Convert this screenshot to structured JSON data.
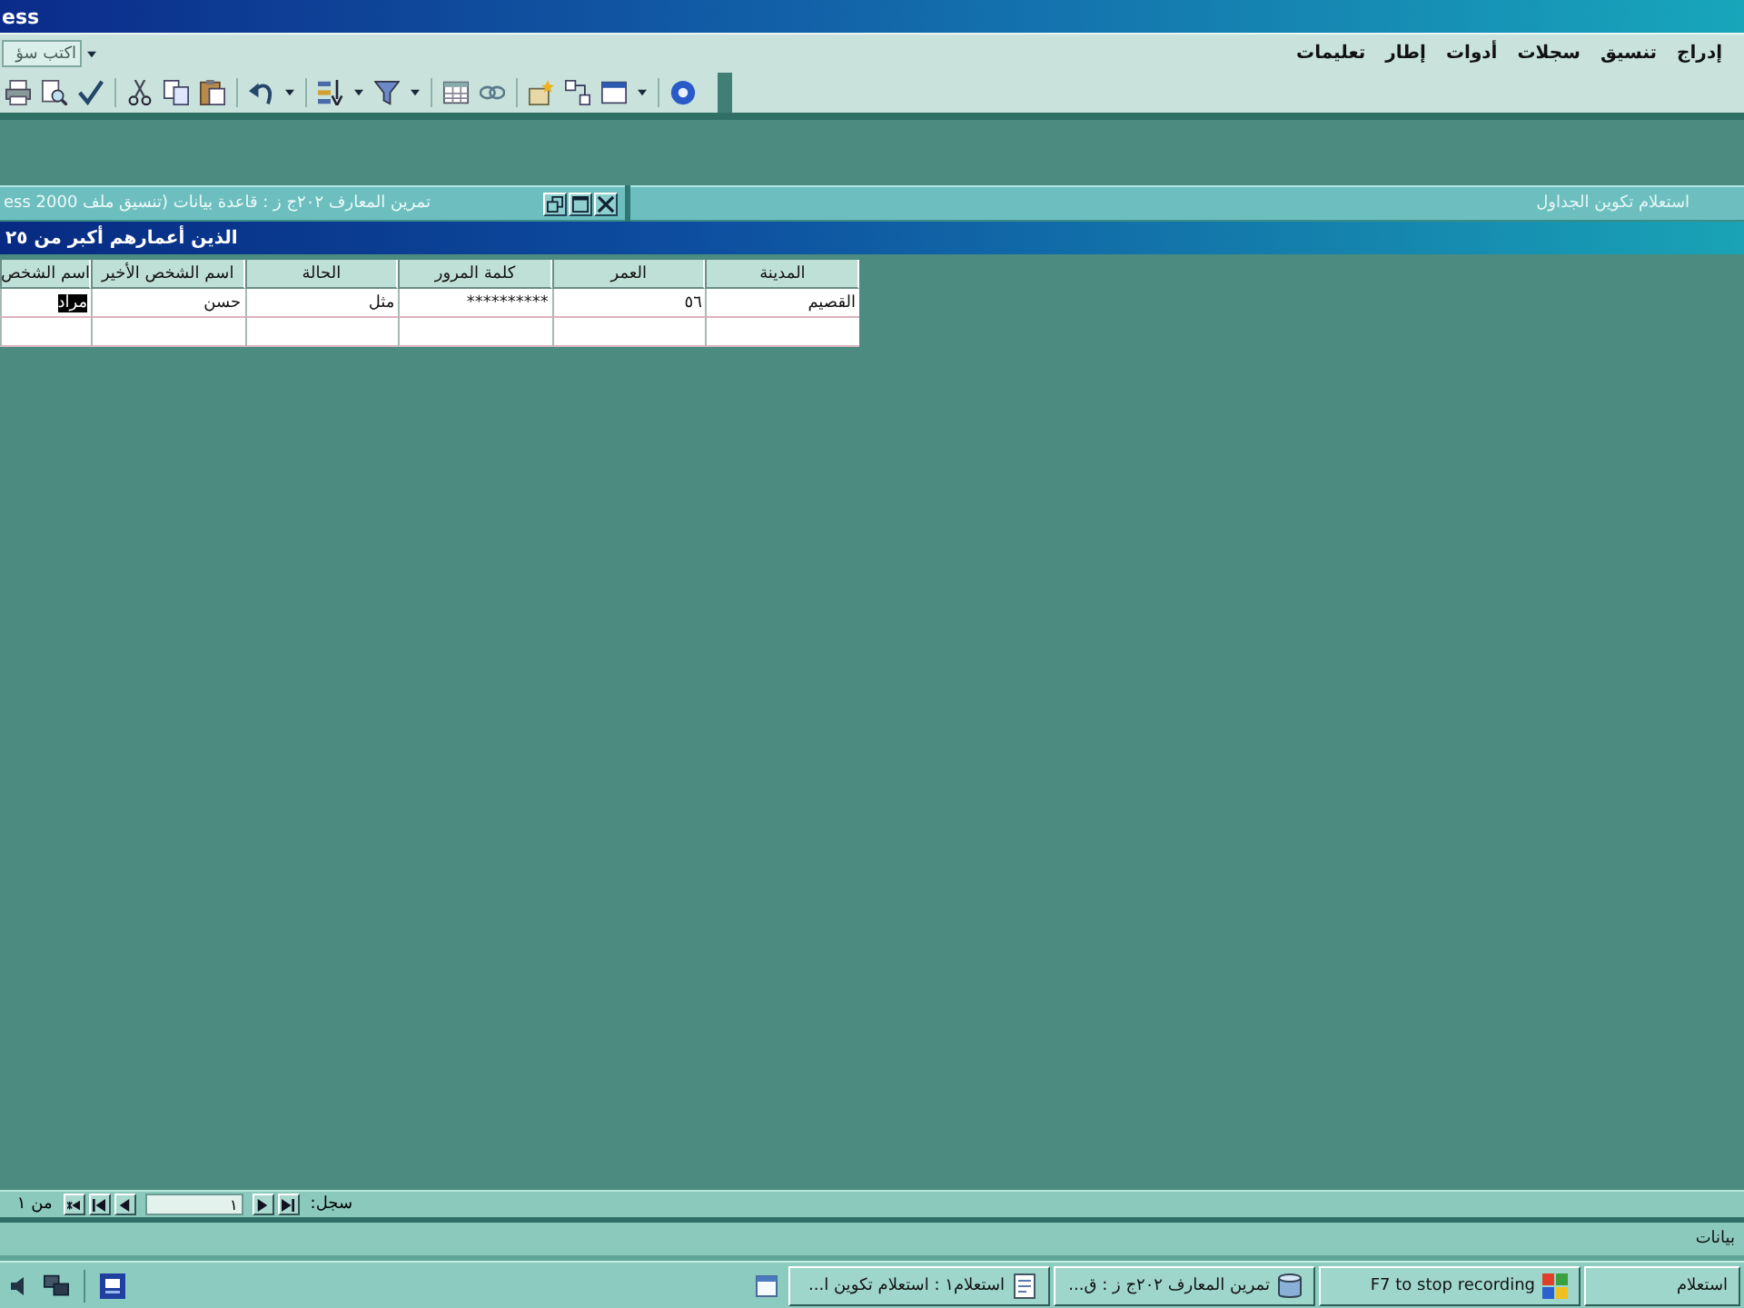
{
  "window": {
    "title": "ess"
  },
  "menu_bar": {
    "help_box": {
      "placeholder": "اكتب سؤ"
    },
    "items": [
      "إدراج",
      "تنسيق",
      "سجلات",
      "أدوات",
      "إطار",
      "تعليمات"
    ]
  },
  "database_window": {
    "title": "تمرين المعارف ٢٠٢ج ز : قاعدة بيانات (تنسيق ملف ess 2000"
  },
  "minimized_window": {
    "title": "استعلام تكوين الجداول"
  },
  "query_window": {
    "title": "الذين أعمارهم أكبر من ٢٥",
    "table": {
      "columns": [
        "المدينة",
        "العمر",
        "كلمة المرور",
        "الحالة",
        "اسم الشخص الأخير",
        "اسم الشخص"
      ],
      "rows": [
        {
          "cells": [
            {
              "text": "القصيم",
              "selected": false
            },
            {
              "text": "٥٦",
              "selected": false
            },
            {
              "text": "**********",
              "selected": false
            },
            {
              "text": "مثل",
              "selected": false
            },
            {
              "text": "حسن",
              "selected": false
            },
            {
              "text": "مراد",
              "selected": true
            }
          ]
        }
      ]
    },
    "record_navigator": {
      "label": "سجل:",
      "current": "١",
      "total": "من ١"
    }
  },
  "status_bar": {
    "text": "بيانات"
  },
  "taskbar": {
    "buttons": [
      {
        "label": "استعلام",
        "kind": "plain"
      },
      {
        "label": "F7 to stop recording",
        "kind": "recorder"
      },
      {
        "label": "تمرين المعارف ٢٠٢ج ز : ق...",
        "kind": "database"
      },
      {
        "label": "استعلام١ : استعلام تكوين ا...",
        "kind": "query"
      }
    ]
  }
}
